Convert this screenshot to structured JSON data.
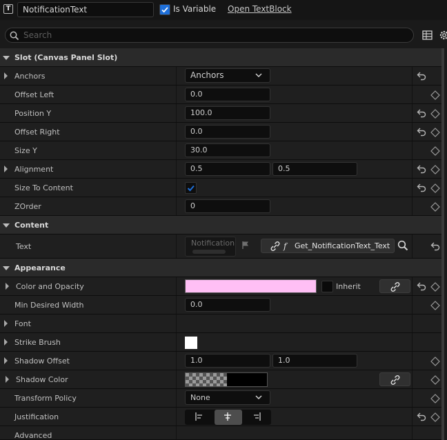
{
  "header": {
    "widget_type_icon": "text-block-icon",
    "widget_name": "NotificationText",
    "is_variable_label": "Is Variable",
    "is_variable_checked": true,
    "open_link": "Open TextBlock"
  },
  "search": {
    "placeholder": "Search"
  },
  "categories": {
    "slot": "Slot (Canvas Panel Slot)",
    "content": "Content",
    "appearance": "Appearance"
  },
  "slot": {
    "anchors": {
      "label": "Anchors",
      "value": "Anchors"
    },
    "offset_left": {
      "label": "Offset Left",
      "value": "0.0"
    },
    "position_y": {
      "label": "Position Y",
      "value": "100.0"
    },
    "offset_right": {
      "label": "Offset Right",
      "value": "0.0"
    },
    "size_y": {
      "label": "Size Y",
      "value": "30.0"
    },
    "alignment": {
      "label": "Alignment",
      "x": "0.5",
      "y": "0.5"
    },
    "size_to_content": {
      "label": "Size To Content",
      "checked": true
    },
    "zorder": {
      "label": "ZOrder",
      "value": "0"
    }
  },
  "content": {
    "text": {
      "label": "Text",
      "preview": "Notification",
      "binding": "Get_NotificationText_Text"
    }
  },
  "appearance": {
    "color_and_opacity": {
      "label": "Color and Opacity",
      "color": "#ffbff5",
      "inherit_label": "Inherit"
    },
    "min_desired_width": {
      "label": "Min Desired Width",
      "value": "0.0"
    },
    "font": {
      "label": "Font"
    },
    "strike_brush": {
      "label": "Strike Brush",
      "color": "#ffffff"
    },
    "shadow_offset": {
      "label": "Shadow Offset",
      "x": "1.0",
      "y": "1.0"
    },
    "shadow_color": {
      "label": "Shadow Color",
      "color": "#000000"
    },
    "transform_policy": {
      "label": "Transform Policy",
      "value": "None"
    },
    "justification": {
      "label": "Justification",
      "options": [
        "left",
        "center",
        "right"
      ],
      "selected": "center"
    },
    "advanced": {
      "label": "Advanced"
    }
  },
  "colors": {
    "accent_check": "#1e6fd9",
    "row_bg": "#1f1f1f",
    "category_bg": "#2a2a2a",
    "field_bg": "#0e0e0e"
  }
}
